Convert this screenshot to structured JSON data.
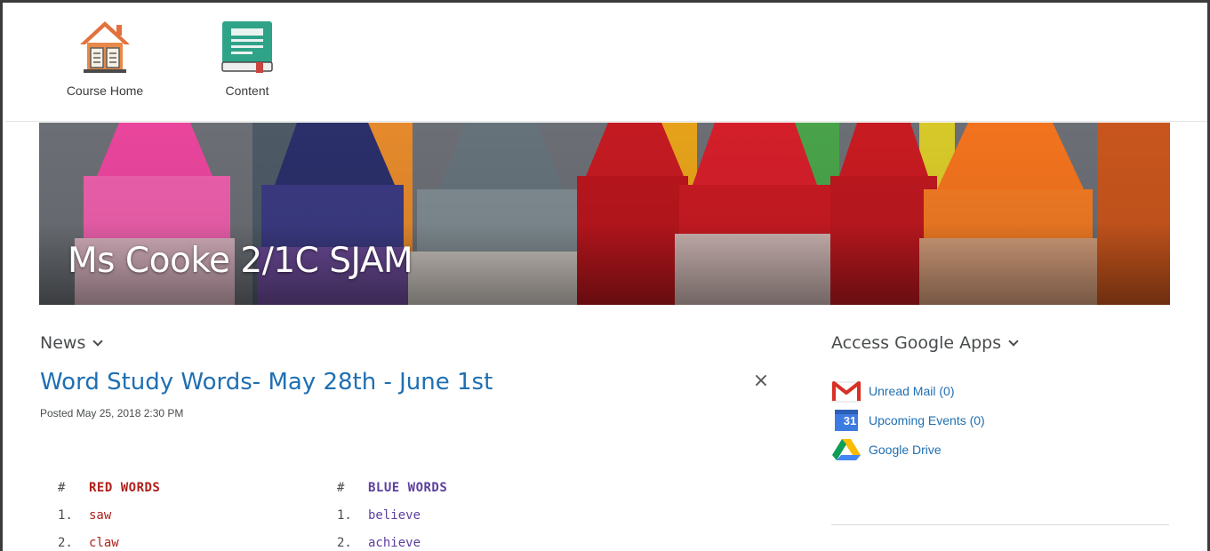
{
  "nav": {
    "items": [
      {
        "label": "Course Home",
        "icon": "house-icon"
      },
      {
        "label": "Content",
        "icon": "book-icon"
      }
    ]
  },
  "banner": {
    "title": "Ms Cooke 2/1C SJAM"
  },
  "news": {
    "heading": "News",
    "item": {
      "title": "Word Study Words- May 28th - June 1st",
      "posted": "Posted May 25, 2018 2:30 PM",
      "close": "×"
    },
    "red_list": {
      "hash": "#",
      "heading": "RED WORDS",
      "rows": [
        {
          "num": "1.",
          "word": "saw"
        },
        {
          "num": "2.",
          "word": "claw"
        }
      ]
    },
    "blue_list": {
      "hash": "#",
      "heading": "BLUE WORDS",
      "rows": [
        {
          "num": "1.",
          "word": "believe"
        },
        {
          "num": "2.",
          "word": "achieve"
        }
      ]
    }
  },
  "google_apps": {
    "heading": "Access Google Apps",
    "items": [
      {
        "label": "Unread Mail (0)",
        "icon": "gmail-icon"
      },
      {
        "label": "Upcoming Events (0)",
        "icon": "calendar-icon",
        "icon_text": "31"
      },
      {
        "label": "Google Drive",
        "icon": "drive-icon"
      }
    ]
  },
  "colors": {
    "link": "#1f6fb2",
    "red_words": "#b0211c",
    "blue_words": "#5c3f9e",
    "text": "#494c4e"
  }
}
